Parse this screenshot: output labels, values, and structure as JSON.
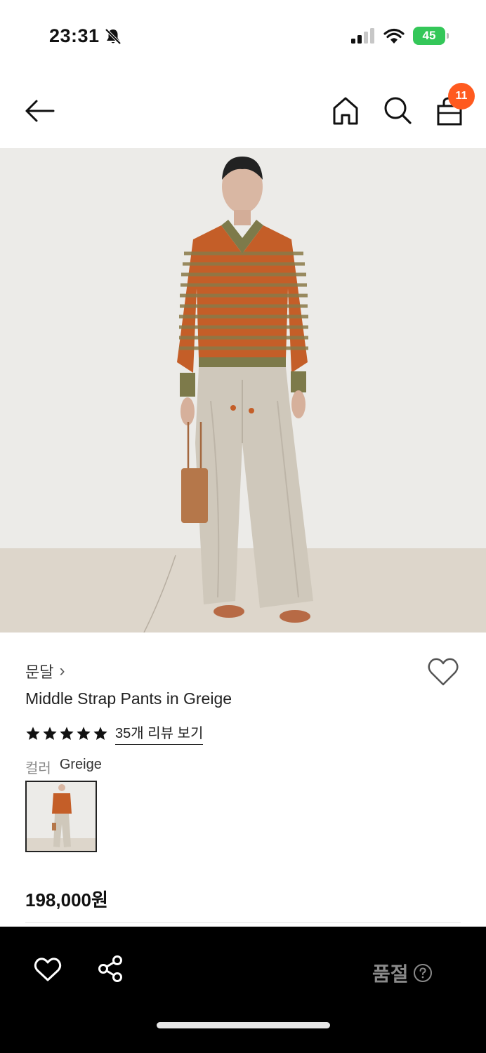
{
  "status_bar": {
    "time": "23:31",
    "battery": "45"
  },
  "nav": {
    "cart_count": "11"
  },
  "product": {
    "brand": "문달",
    "brand_chevron": "›",
    "name": "Middle Strap Pants in Greige",
    "rating_stars": 5,
    "review_link": "35개 리뷰 보기",
    "color_label": "컬러",
    "color_value": "Greige",
    "price": "198,000원"
  },
  "bottom_bar": {
    "status_label": "품절"
  },
  "icons": [
    "back-arrow-icon",
    "home-icon",
    "search-icon",
    "shopping-bag-icon",
    "heart-icon",
    "star-icon",
    "share-icon",
    "help-icon",
    "muted-bell-icon",
    "signal-icon",
    "wifi-icon"
  ],
  "colors": {
    "badge": "#ff5a1f",
    "battery": "#34c759",
    "bottom_bar": "#000000"
  }
}
